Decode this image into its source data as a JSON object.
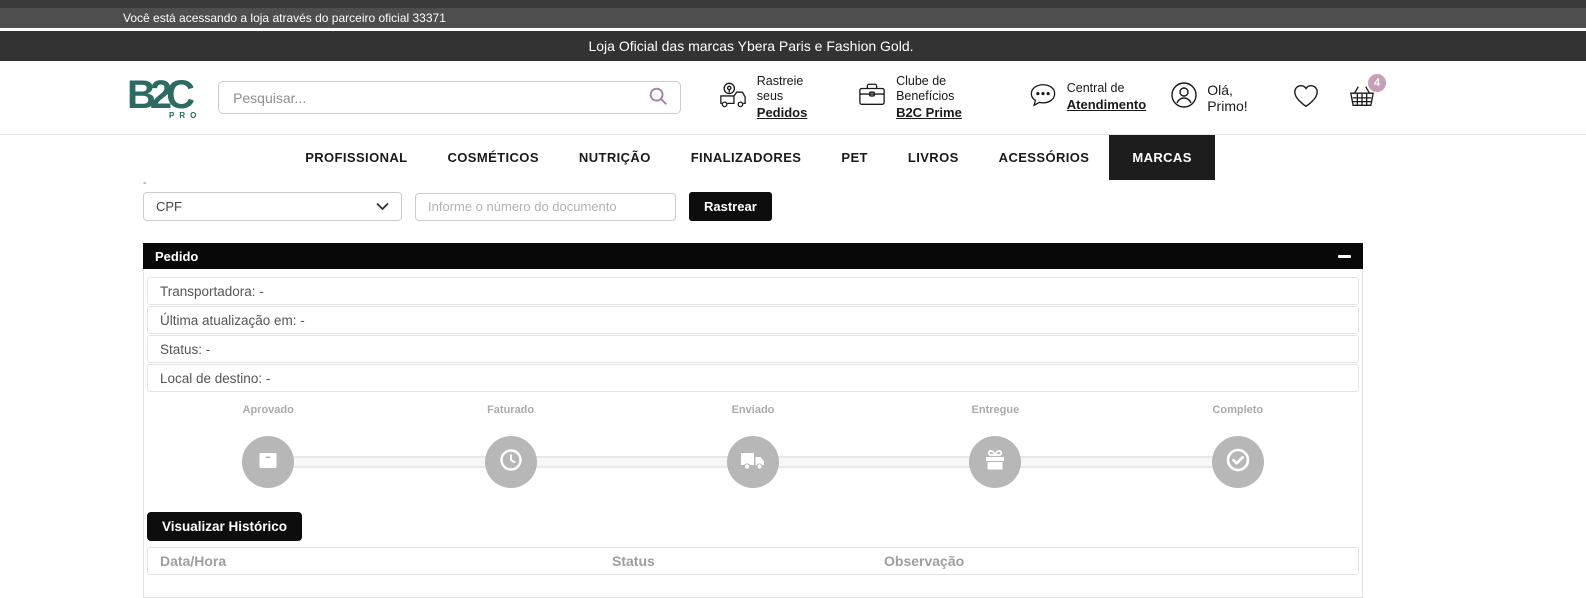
{
  "top_bars": {
    "partner_notice": "Você está acessando a loja através do parceiro oficial 33371",
    "official_notice": "Loja Oficial das marcas Ybera Paris e Fashion Gold."
  },
  "header": {
    "logo": {
      "main": "B2C",
      "sub": "PRO"
    },
    "search": {
      "placeholder": "Pesquisar..."
    },
    "links": [
      {
        "icon": "delivery-truck-icon",
        "line1": "Rastreie seus",
        "line2": "Pedidos"
      },
      {
        "icon": "briefcase-icon",
        "line1": "Clube de Benefícios",
        "line2": "B2C Prime"
      },
      {
        "icon": "chat-bubble-icon",
        "line1": "Central de",
        "line2": "Atendimento"
      }
    ],
    "greeting": "Olá,  Primo!",
    "cart_count": "4"
  },
  "nav": {
    "items": [
      "PROFISSIONAL",
      "COSMÉTICOS",
      "NUTRIÇÃO",
      "FINALIZADORES",
      "PET",
      "LIVROS",
      "ACESSÓRIOS",
      "MARCAS"
    ],
    "active": "MARCAS"
  },
  "tracker_form": {
    "label_dash": "-",
    "document_type_selected": "CPF",
    "document_placeholder": "Informe o número do documento",
    "submit_label": "Rastrear"
  },
  "order_panel": {
    "title": "Pedido",
    "fields": [
      {
        "text": "Transportadora: -"
      },
      {
        "text": "Última atualização em: -"
      },
      {
        "text": "Status: -"
      },
      {
        "text": "Local de destino: -"
      }
    ],
    "steps": [
      {
        "label": "Aprovado",
        "icon": "package-box-icon"
      },
      {
        "label": "Faturado",
        "icon": "clock-icon"
      },
      {
        "label": "Enviado",
        "icon": "truck-icon"
      },
      {
        "label": "Entregue",
        "icon": "gift-icon"
      },
      {
        "label": "Completo",
        "icon": "check-circle-icon"
      }
    ],
    "history_button": "Visualizar Histórico",
    "history_table": {
      "columns": [
        "Data/Hora",
        "Status",
        "Observação"
      ]
    }
  },
  "colors": {
    "brand_teal": "#2c6a62",
    "accent_purple": "#a77daa",
    "badge_pink": "#c79fb6",
    "bar_dark": "#333333",
    "bar_medium": "#4e4e4e",
    "button_black": "#0d0d0d",
    "step_gray": "#b7b7b7"
  }
}
